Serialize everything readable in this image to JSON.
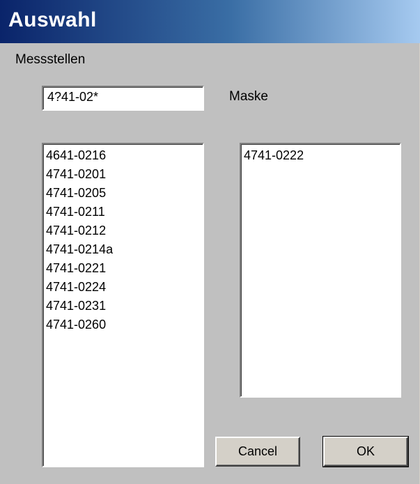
{
  "window": {
    "title": "Auswahl"
  },
  "labels": {
    "messstellen": "Messstellen",
    "maske": "Maske"
  },
  "mask_input": {
    "value": "4?41-02*"
  },
  "available_list": {
    "items": [
      "4641-0216",
      "4741-0201",
      "4741-0205",
      "4741-0211",
      "4741-0212",
      "4741-0214a",
      "4741-0221",
      "4741-0224",
      "4741-0231",
      "4741-0260"
    ]
  },
  "selected_list": {
    "items": [
      "4741-0222"
    ]
  },
  "buttons": {
    "cancel": "Cancel",
    "ok": "OK"
  }
}
